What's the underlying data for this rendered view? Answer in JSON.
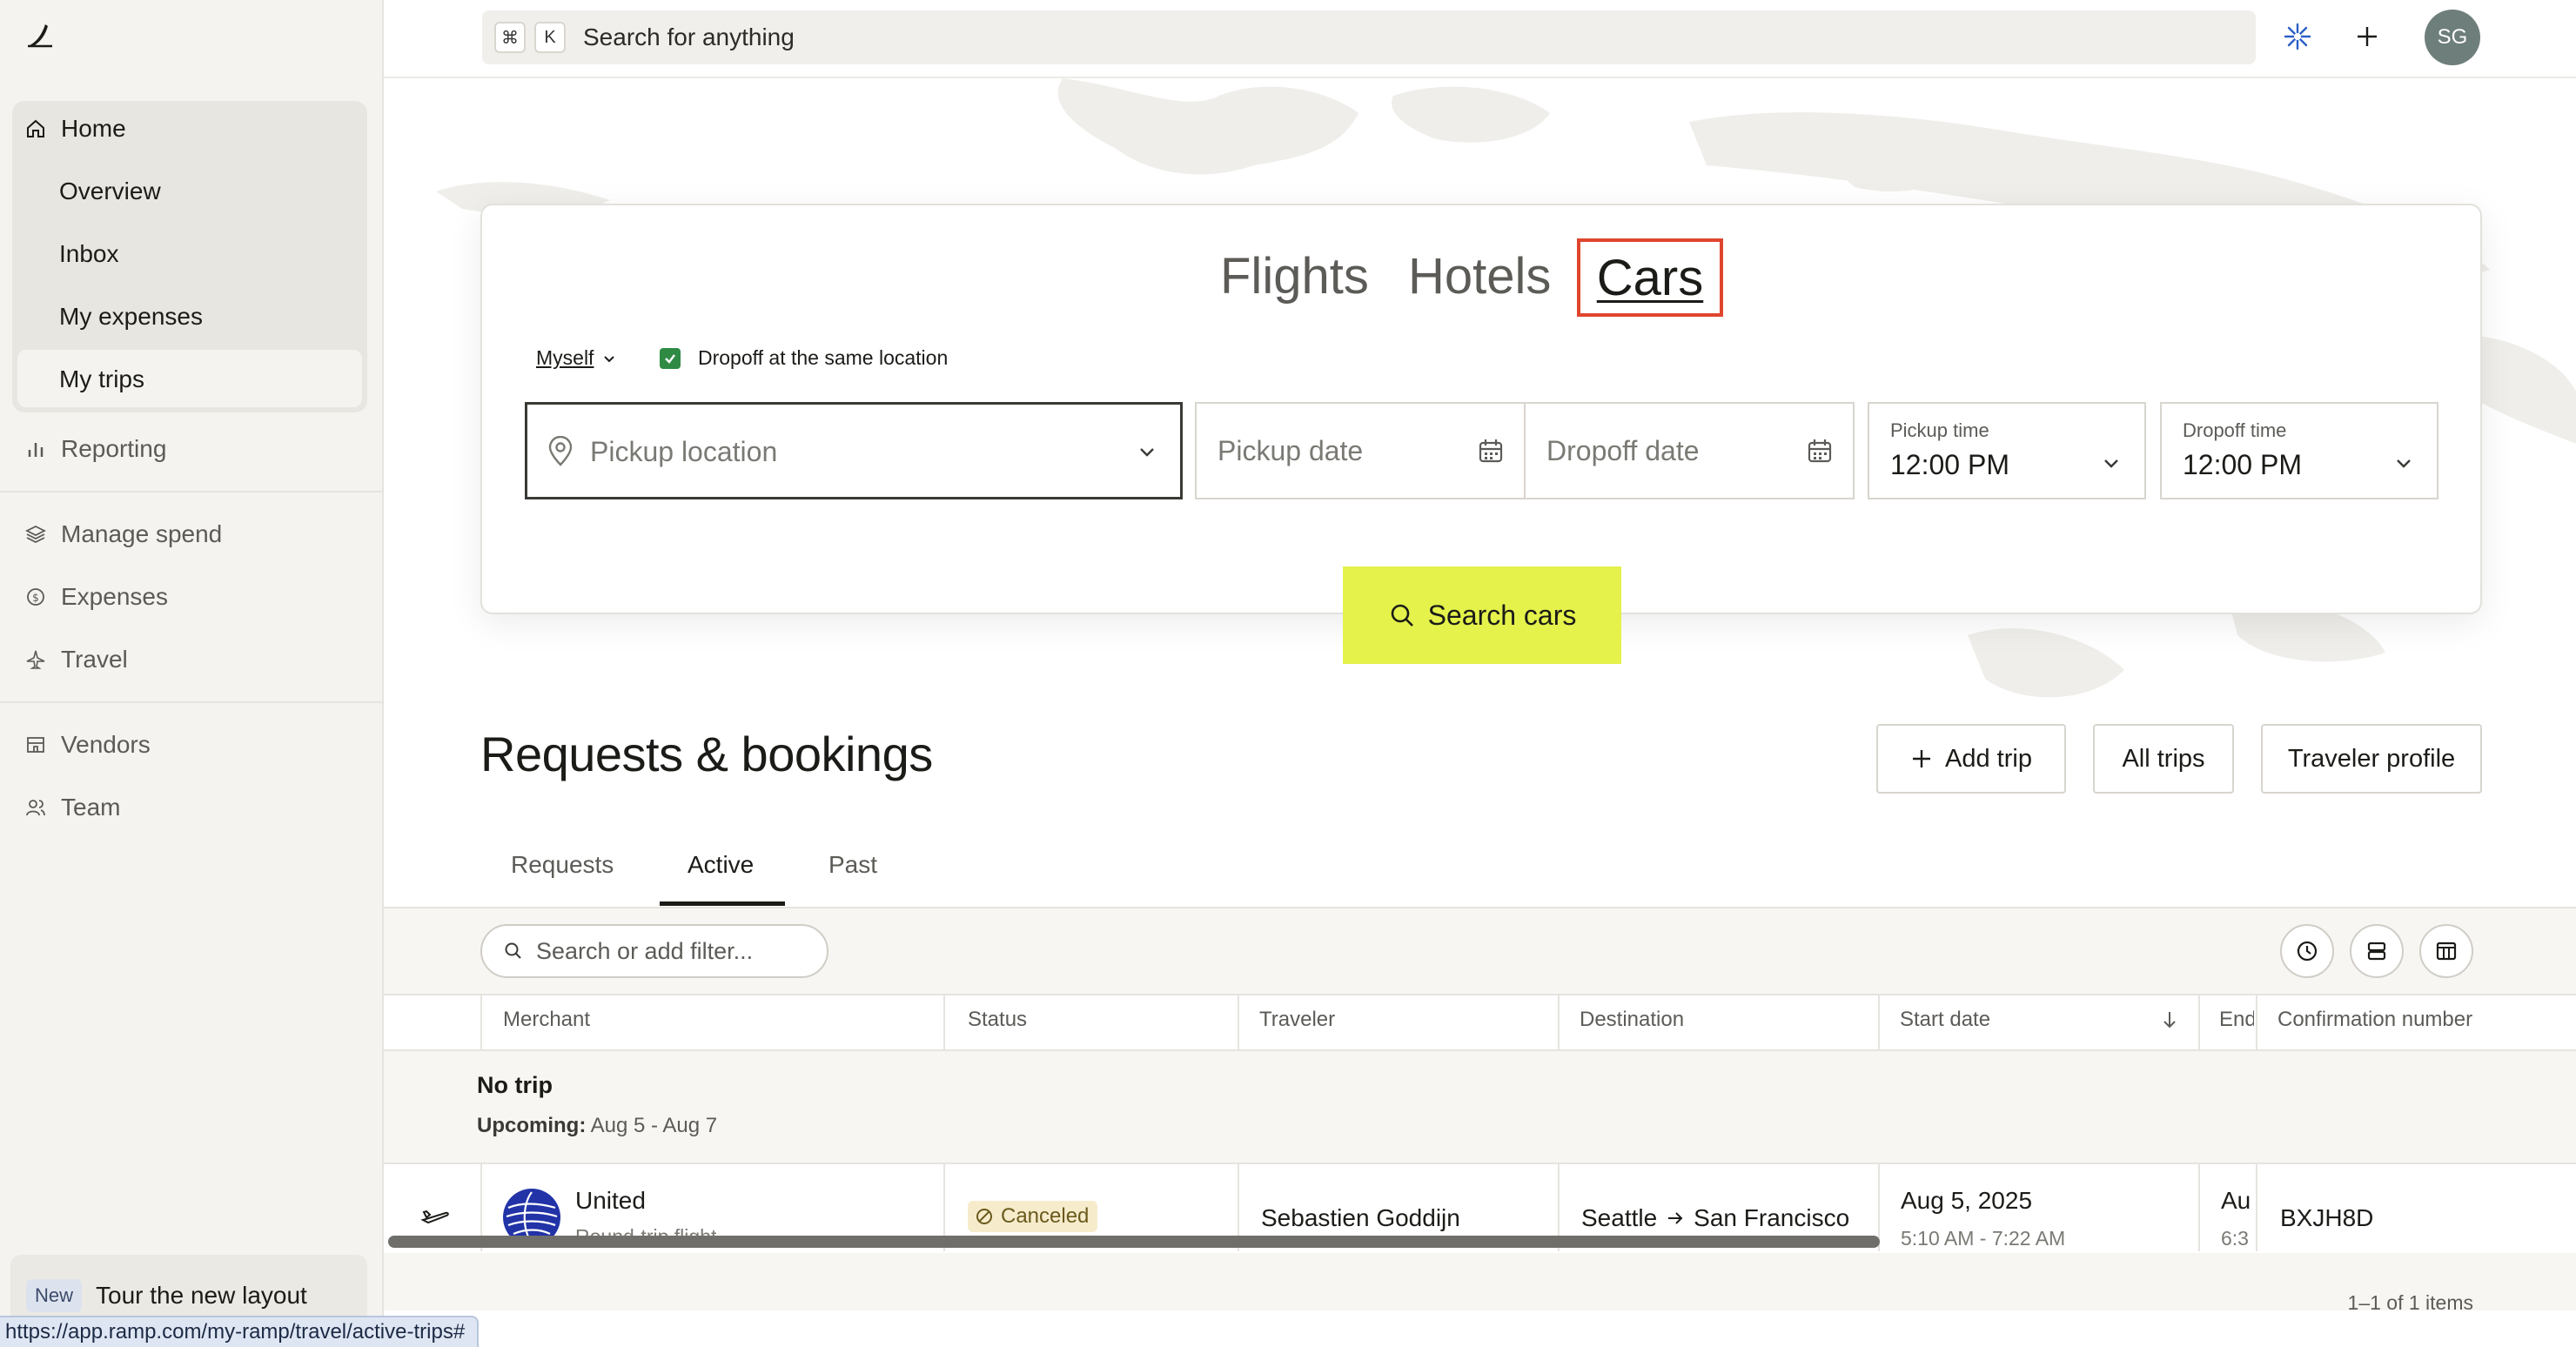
{
  "sidebar": {
    "home": "Home",
    "overview": "Overview",
    "inbox": "Inbox",
    "my_expenses": "My expenses",
    "my_trips": "My trips",
    "reporting": "Reporting",
    "manage_spend": "Manage spend",
    "expenses": "Expenses",
    "travel": "Travel",
    "vendors": "Vendors",
    "team": "Team",
    "tour_badge": "New",
    "tour_label": "Tour the new layout"
  },
  "status_bar_url": "https://app.ramp.com/my-ramp/travel/active-trips#",
  "topbar": {
    "kbd_cmd": "⌘",
    "kbd_k": "K",
    "search_placeholder": "Search for anything",
    "avatar_initials": "SG"
  },
  "booking": {
    "tabs": [
      "Flights",
      "Hotels",
      "Cars"
    ],
    "selected_tab": "Cars",
    "traveler_select": "Myself",
    "dropoff_same_label": "Dropoff at the same location",
    "dropoff_same_checked": true,
    "pickup_location_placeholder": "Pickup location",
    "pickup_date_placeholder": "Pickup date",
    "dropoff_date_placeholder": "Dropoff date",
    "pickup_time_label": "Pickup time",
    "pickup_time_value": "12:00 PM",
    "dropoff_time_label": "Dropoff time",
    "dropoff_time_value": "12:00 PM",
    "search_button": "Search cars"
  },
  "requests": {
    "title": "Requests & bookings",
    "add_trip": "Add trip",
    "all_trips": "All trips",
    "traveler_profile": "Traveler profile",
    "tabs": [
      "Requests",
      "Active",
      "Past"
    ],
    "active_tab": "Active",
    "filter_placeholder": "Search or add filter...",
    "columns": [
      "Merchant",
      "Status",
      "Traveler",
      "Destination",
      "Start date",
      "End",
      "Confirmation number"
    ],
    "group": {
      "title": "No trip",
      "sub_label": "Upcoming:",
      "sub_value": "Aug 5 - Aug 7"
    },
    "rows": [
      {
        "merchant": "United",
        "merchant_sub": "Round-trip flight",
        "status": "Canceled",
        "traveler": "Sebastien Goddijn",
        "origin": "Seattle",
        "destination": "San Francisco",
        "start_date": "Aug 5, 2025",
        "start_time": "5:10 AM - 7:22 AM",
        "end_date": "Au",
        "end_time": "6:3",
        "confirmation": "BXJH8D"
      }
    ],
    "pagination": "1–1 of 1 items"
  },
  "colors": {
    "accent_yellow": "#e4f24b",
    "highlight_red": "#e0452e",
    "checkbox_green": "#2f8a43",
    "sidebar_bg": "#f4f3f0"
  }
}
